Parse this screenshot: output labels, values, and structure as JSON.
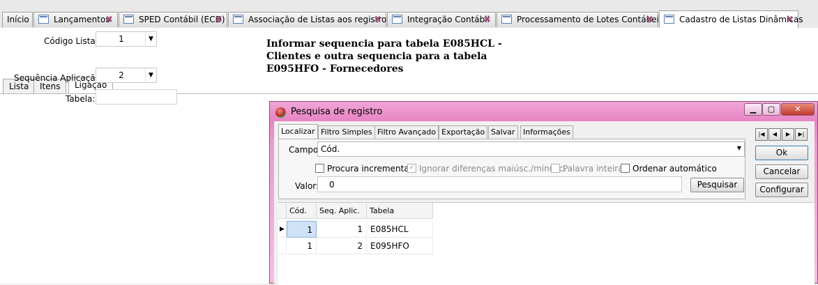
{
  "tabs": [
    {
      "label": "Início",
      "icon": "none",
      "closable": false
    },
    {
      "label": "Lançamentos",
      "icon": "document-icon",
      "closable": true
    },
    {
      "label": "SPED Contábil (ECD)",
      "icon": "document-icon",
      "closable": true
    },
    {
      "label": "Associação de Listas aos registros",
      "icon": "document-icon",
      "closable": true
    },
    {
      "label": "Integração Contábil",
      "icon": "document-icon",
      "closable": true
    },
    {
      "label": "Processamento de Lotes Contábeis",
      "icon": "document-icon",
      "closable": true
    },
    {
      "label": "Cadastro de Listas Dinâmicas",
      "icon": "document-icon",
      "closable": true,
      "active": true
    }
  ],
  "form": {
    "codigo_label": "Código Lista:",
    "codigo_value": "1",
    "subtabs": [
      "Lista",
      "Itens",
      "Ligação"
    ],
    "active_subtab": "Ligação",
    "sequencia_label": "Sequência Aplicação:",
    "sequencia_value": "2",
    "tabela_label": "Tabela:",
    "tabela_value": ""
  },
  "annotation": {
    "line1": "Informar sequencia para tabela E085HCL -",
    "line2": "Clientes e outra sequencia para a tabela",
    "line3": "E095HFO - Fornecedores"
  },
  "dialog": {
    "title": "Pesquisa de registro",
    "tabs": [
      "Localizar",
      "Filtro Simples",
      "Filtro Avançado",
      "Exportação",
      "Salvar",
      "Informações"
    ],
    "active_tab": "Localizar",
    "campo_label": "Campo:",
    "campo_value": "Cód.",
    "checkboxes": [
      {
        "label": "Procura incremental",
        "checked": false,
        "enabled": true
      },
      {
        "label": "Ignorar diferenças maiúsc./minúsc.",
        "checked": true,
        "enabled": false
      },
      {
        "label": "Palavra inteira",
        "checked": false,
        "enabled": false
      },
      {
        "label": "Ordenar automático",
        "checked": false,
        "enabled": true
      }
    ],
    "valor_label": "Valor:",
    "valor_value": "0",
    "pesquisar_label": "Pesquisar",
    "ok_label": "Ok",
    "cancelar_label": "Cancelar",
    "configurar_label": "Configurar",
    "nav_icons": [
      "first-record-icon",
      "previous-record-icon",
      "next-record-icon",
      "last-record-icon"
    ],
    "grid": {
      "columns": [
        "Cód.",
        "Seq. Aplic.",
        "Tabela"
      ],
      "rows": [
        {
          "cod": "1",
          "seq": "1",
          "tabela": "E085HCL",
          "selected": true
        },
        {
          "cod": "1",
          "seq": "2",
          "tabela": "E095HFO",
          "selected": false
        }
      ]
    }
  },
  "colors": {
    "dialog_frame": "#e884c4",
    "selection": "#cfe2f7",
    "tab_close": "#a0507a"
  }
}
